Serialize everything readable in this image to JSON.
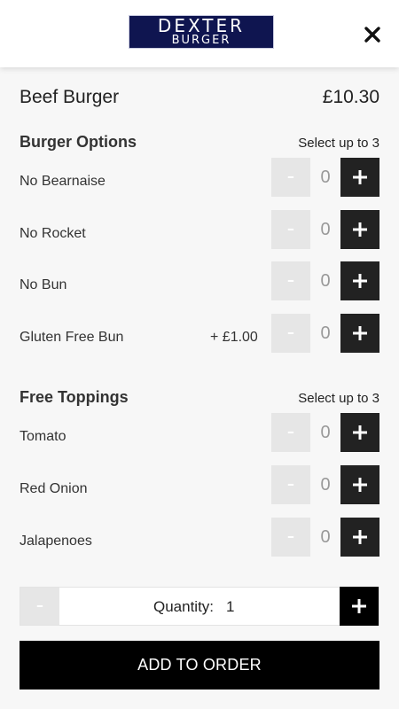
{
  "header": {
    "logo_line1": "DEXTER",
    "logo_line2": "BURGER",
    "close_icon": "close-icon"
  },
  "item": {
    "name": "Beef Burger",
    "price": "£10.30"
  },
  "sections": [
    {
      "title": "Burger Options",
      "note": "Select up to 3",
      "options": [
        {
          "label": "No Bearnaise",
          "extra": "",
          "count": "0"
        },
        {
          "label": "No Rocket",
          "extra": "",
          "count": "0"
        },
        {
          "label": "No Bun",
          "extra": "",
          "count": "0"
        },
        {
          "label": "Gluten Free Bun",
          "extra": "+ £1.00",
          "count": "0"
        }
      ]
    },
    {
      "title": "Free Toppings",
      "note": "Select up to 3",
      "options": [
        {
          "label": "Tomato",
          "extra": "",
          "count": "0"
        },
        {
          "label": "Red Onion",
          "extra": "",
          "count": "0"
        },
        {
          "label": "Jalapenoes",
          "extra": "",
          "count": "0"
        }
      ]
    }
  ],
  "stepper": {
    "minus_symbol": "-"
  },
  "quantity": {
    "label": "Quantity:",
    "value": "1"
  },
  "actions": {
    "add_label": "ADD TO ORDER"
  },
  "colors": {
    "logo_bg": "#0f1550",
    "plus_bg": "#222222",
    "minus_bg": "#e6e6e6",
    "cta_bg": "#000000"
  }
}
